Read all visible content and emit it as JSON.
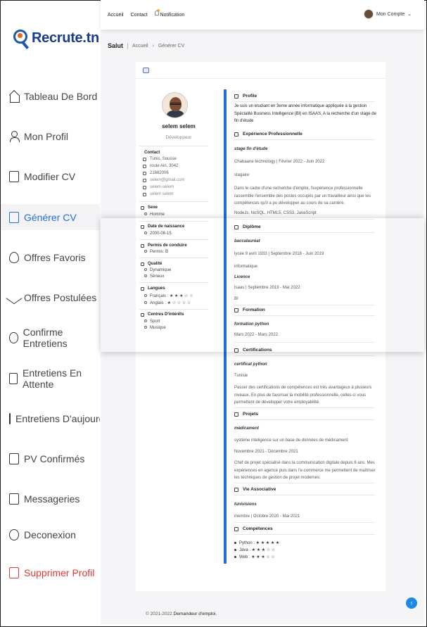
{
  "topbar": {
    "nav": [
      "Accueil",
      "Contact"
    ],
    "notification": "Notification",
    "account": "Mon Compte"
  },
  "brand": {
    "name": "Recrute.tn"
  },
  "sidebar": {
    "items": [
      {
        "label": "Tableau De Bord",
        "icon": "home-icon"
      },
      {
        "label": "Mon Profil",
        "icon": "user-icon"
      },
      {
        "label": "Modifier CV",
        "icon": "edit-document-icon"
      },
      {
        "label": "Générer CV",
        "icon": "document-icon",
        "active": true
      },
      {
        "label": "Offres Favoris",
        "icon": "heart-icon"
      },
      {
        "label": "Offres Postulées",
        "icon": "send-icon"
      },
      {
        "label": "Confirme Entretiens",
        "icon": "check-circle-icon"
      },
      {
        "label": "Entretiens En Attente",
        "icon": "calendar-icon"
      },
      {
        "label": "Entretiens D'aujourd'hui",
        "icon": "calendar-check-icon"
      },
      {
        "label": "PV Confirmés",
        "icon": "clipboard-check-icon"
      },
      {
        "label": "Messageries",
        "icon": "inbox-icon"
      },
      {
        "label": "Deconexion",
        "icon": "logout-icon"
      },
      {
        "label": "Supprimer Profil",
        "icon": "trash-icon",
        "danger": true
      }
    ]
  },
  "breadcrumb": {
    "page": "Salut",
    "home": "Accueil",
    "current": "Générer CV"
  },
  "cv": {
    "name": "selem selem",
    "role": "Développeur",
    "contact": {
      "title": "Contact",
      "lines": [
        "Tunis, Sousse",
        "route Ain, 3042",
        "21682006",
        "selem@gmail.com",
        "selem-selem",
        "selem selem"
      ]
    },
    "sexe": {
      "title": "Sexe",
      "items": [
        "Homme"
      ]
    },
    "naissance": {
      "title": "Date de naissance",
      "items": [
        "2000-08-15"
      ]
    },
    "permis": {
      "title": "Permis de conduire",
      "items": [
        "Permis: B"
      ]
    },
    "qualite": {
      "title": "Qualité",
      "items": [
        "Dynamique",
        "Sérieux"
      ]
    },
    "langues": {
      "title": "Langues",
      "items": [
        "Français : ★ ★ ★ ☆ ☆",
        "Anglais : ★ ☆ ☆ ☆ ☆"
      ]
    },
    "centres": {
      "title": "Centres D'intérêts",
      "items": [
        "Sport",
        "Musique"
      ]
    },
    "profil": {
      "title": "Profile",
      "text": "Je suis un etudiant en 3eme année informatique appliquée à la gestion Spécialité Business Intelligence (BI) en ISAAS, A la recherche d'un stage de fin d'étude"
    },
    "experience": {
      "title": "Expérience Professionnelle",
      "job": "stage fin d'étude",
      "company": "Chabaane technology | Février 2022 - Juin 2022",
      "type": "stagaire",
      "desc": "Dans le cadre d'une recherche d'emploi, l'expérience professionnelle rassemble l'ensemble des postes occupés par un travailleur ainsi que les compétences qu'il a pu développer au cours de sa carrière.",
      "skills": "NodeJs, NoSQL, HTML5, CSS3, JavaScript"
    },
    "diplome": {
      "title": "Diplôme",
      "d1": "baccalauréat",
      "d1_school": "lycée 9 avril 1933 | Septembre 2018 - Juin 2019",
      "d1_field": "informatique",
      "d2": "Licence",
      "d2_school": "Isaas | Septembre 2019 - Mai 2022",
      "d2_field": "BI"
    },
    "formation": {
      "title": "Formation",
      "name": "formation python",
      "dates": "Mars 2022 - Mars 2022"
    },
    "certifications": {
      "title": "Certifications",
      "name": "certificat python",
      "place": "Tunisie",
      "desc": "Passer des certifications de compétences est très avantageux à plusieurs niveaux. En plus de favoriser la mobilité professionnelle, celles-ci vous permettent de développer votre employabilité."
    },
    "projets": {
      "title": "Projets",
      "name": "médicament",
      "desc1": "système inteligence sur un base de données de médicament",
      "dates": "Novembre 2021 - Décembre 2021",
      "desc2": "Chef de projet spécialisé dans la communication digitale depuis 6 ans. Mes expériences en agence puis dans l'e-commerce me permettent de maîtriser les techniques de gestion de projet modernes."
    },
    "vie": {
      "title": "Vie Associative",
      "name": "tunivisions",
      "role": "membre | Octobre 2020 - Mai 2021"
    },
    "competences": {
      "title": "Compétences",
      "items": [
        "Python : ★ ★ ★ ★ ★",
        "Java : ★ ★ ★ ☆ ☆",
        "Web : ★ ★ ★ ☆ ☆"
      ]
    }
  },
  "footer": {
    "copy": "© 2021-2022",
    "name": "Demandeur d'emploi."
  },
  "colors": {
    "accent": "#1e6fd9",
    "danger": "#e53935",
    "brand": "#1a3c8c"
  }
}
